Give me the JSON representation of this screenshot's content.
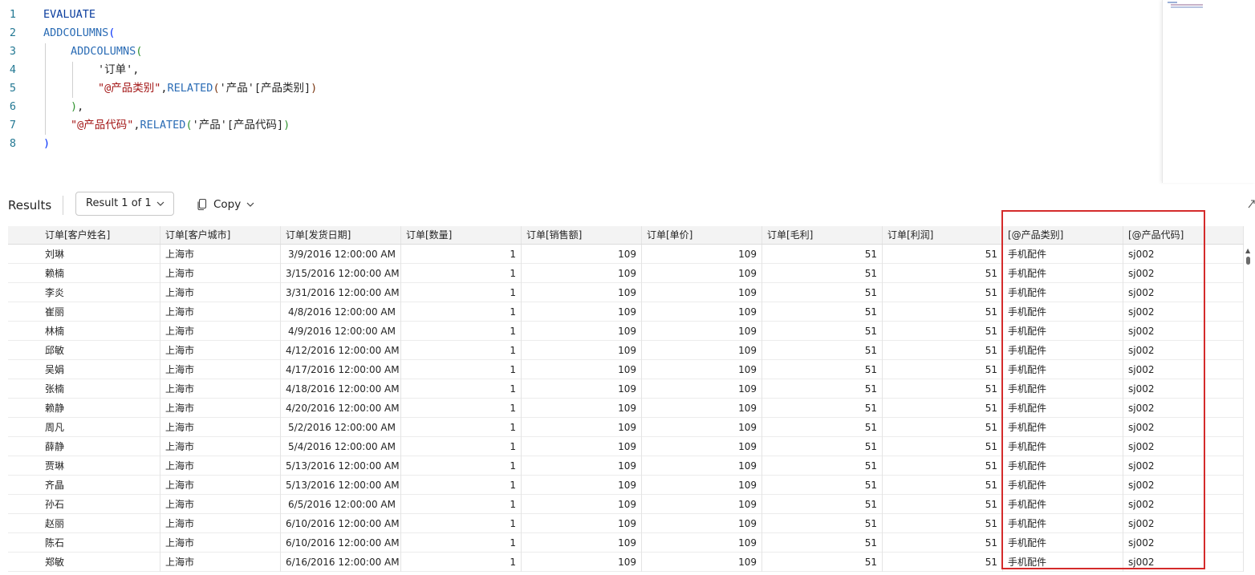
{
  "editor": {
    "line_numbers": [
      "1",
      "2",
      "3",
      "4",
      "5",
      "6",
      "7",
      "8"
    ],
    "line1": "EVALUATE",
    "line2_fn": "ADDCOLUMNS",
    "line2_paren": "(",
    "line3_fn": "ADDCOLUMNS",
    "line3_paren": "(",
    "line4": "'订单',",
    "line5_str": "\"@产品类别\"",
    "line5_comma": ",",
    "line5_fn": "RELATED",
    "line5_open": "(",
    "line5_table": "'产品'",
    "line5_col": "[产品类别]",
    "line5_close": ")",
    "line6_paren": ")",
    "line6_comma": ",",
    "line7_str": "\"@产品代码\"",
    "line7_comma": ",",
    "line7_fn": "RELATED",
    "line7_open": "(",
    "line7_table": "'产品'",
    "line7_col": "[产品代码]",
    "line7_close": ")",
    "line8": ")"
  },
  "results": {
    "label": "Results",
    "selector": "Result 1 of 1",
    "copy_label": "Copy"
  },
  "colors": {
    "highlight_border": "#d42b2b",
    "keyword": "#0a3d9e",
    "string": "#a31515"
  },
  "table": {
    "headers": [
      "订单[客户姓名]",
      "订单[客户城市]",
      "订单[发货日期]",
      "订单[数量]",
      "订单[销售额]",
      "订单[单价]",
      "订单[毛利]",
      "订单[利润]",
      "[@产品类别]",
      "[@产品代码]"
    ],
    "rows": [
      [
        "刘琳",
        "上海市",
        "3/9/2016 12:00:00 AM",
        "1",
        "109",
        "109",
        "51",
        "51",
        "手机配件",
        "sj002"
      ],
      [
        "赖楠",
        "上海市",
        "3/15/2016 12:00:00 AM",
        "1",
        "109",
        "109",
        "51",
        "51",
        "手机配件",
        "sj002"
      ],
      [
        "李炎",
        "上海市",
        "3/31/2016 12:00:00 AM",
        "1",
        "109",
        "109",
        "51",
        "51",
        "手机配件",
        "sj002"
      ],
      [
        "崔丽",
        "上海市",
        "4/8/2016 12:00:00 AM",
        "1",
        "109",
        "109",
        "51",
        "51",
        "手机配件",
        "sj002"
      ],
      [
        "林楠",
        "上海市",
        "4/9/2016 12:00:00 AM",
        "1",
        "109",
        "109",
        "51",
        "51",
        "手机配件",
        "sj002"
      ],
      [
        "邱敏",
        "上海市",
        "4/12/2016 12:00:00 AM",
        "1",
        "109",
        "109",
        "51",
        "51",
        "手机配件",
        "sj002"
      ],
      [
        "吴娟",
        "上海市",
        "4/17/2016 12:00:00 AM",
        "1",
        "109",
        "109",
        "51",
        "51",
        "手机配件",
        "sj002"
      ],
      [
        "张楠",
        "上海市",
        "4/18/2016 12:00:00 AM",
        "1",
        "109",
        "109",
        "51",
        "51",
        "手机配件",
        "sj002"
      ],
      [
        "赖静",
        "上海市",
        "4/20/2016 12:00:00 AM",
        "1",
        "109",
        "109",
        "51",
        "51",
        "手机配件",
        "sj002"
      ],
      [
        "周凡",
        "上海市",
        "5/2/2016 12:00:00 AM",
        "1",
        "109",
        "109",
        "51",
        "51",
        "手机配件",
        "sj002"
      ],
      [
        "薛静",
        "上海市",
        "5/4/2016 12:00:00 AM",
        "1",
        "109",
        "109",
        "51",
        "51",
        "手机配件",
        "sj002"
      ],
      [
        "贾琳",
        "上海市",
        "5/13/2016 12:00:00 AM",
        "1",
        "109",
        "109",
        "51",
        "51",
        "手机配件",
        "sj002"
      ],
      [
        "齐晶",
        "上海市",
        "5/13/2016 12:00:00 AM",
        "1",
        "109",
        "109",
        "51",
        "51",
        "手机配件",
        "sj002"
      ],
      [
        "孙石",
        "上海市",
        "6/5/2016 12:00:00 AM",
        "1",
        "109",
        "109",
        "51",
        "51",
        "手机配件",
        "sj002"
      ],
      [
        "赵丽",
        "上海市",
        "6/10/2016 12:00:00 AM",
        "1",
        "109",
        "109",
        "51",
        "51",
        "手机配件",
        "sj002"
      ],
      [
        "陈石",
        "上海市",
        "6/10/2016 12:00:00 AM",
        "1",
        "109",
        "109",
        "51",
        "51",
        "手机配件",
        "sj002"
      ],
      [
        "郑敏",
        "上海市",
        "6/16/2016 12:00:00 AM",
        "1",
        "109",
        "109",
        "51",
        "51",
        "手机配件",
        "sj002"
      ]
    ]
  }
}
